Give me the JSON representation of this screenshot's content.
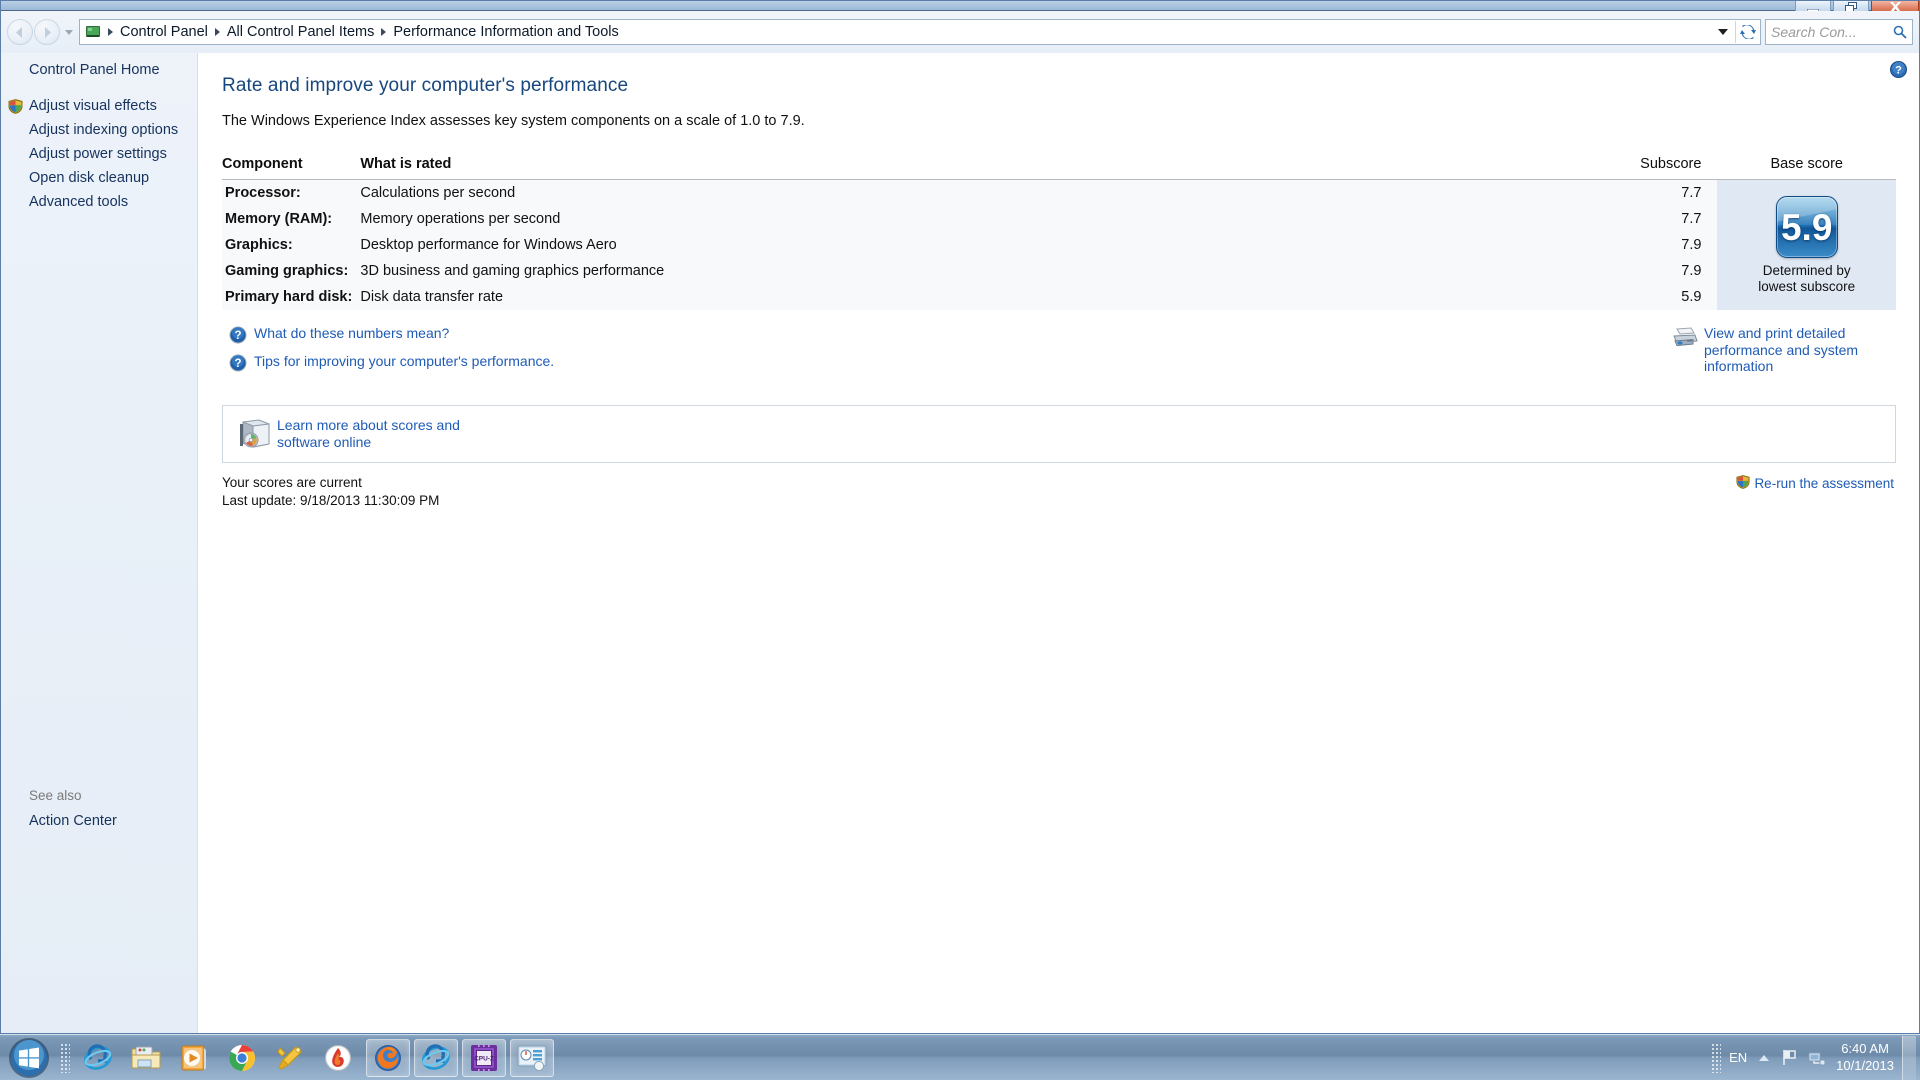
{
  "window": {
    "title_buttons": {
      "minimize": "Minimize",
      "restore": "Restore",
      "close": "Close"
    }
  },
  "nav": {
    "back_label": "Back",
    "forward_label": "Forward",
    "recent_pages_label": "Recent pages",
    "breadcrumbs": [
      "Control Panel",
      "All Control Panel Items",
      "Performance Information and Tools"
    ],
    "dropdown_label": "Previous locations",
    "refresh_label": "Refresh",
    "search_placeholder": "Search Con..."
  },
  "sidebar": {
    "home": "Control Panel Home",
    "items": [
      {
        "label": "Adjust visual effects",
        "shield": true
      },
      {
        "label": "Adjust indexing options",
        "shield": false
      },
      {
        "label": "Adjust power settings",
        "shield": false
      },
      {
        "label": "Open disk cleanup",
        "shield": false
      },
      {
        "label": "Advanced tools",
        "shield": false
      }
    ],
    "see_also_title": "See also",
    "see_also_items": [
      {
        "label": "Action Center"
      }
    ]
  },
  "content": {
    "help_label": "Help",
    "title": "Rate and improve your computer's performance",
    "subtitle": "The Windows Experience Index assesses key system components on a scale of 1.0 to 7.9.",
    "table": {
      "headers": {
        "component": "Component",
        "what_is_rated": "What is rated",
        "subscore": "Subscore",
        "base_score": "Base score"
      },
      "rows": [
        {
          "component": "Processor:",
          "what_is_rated": "Calculations per second",
          "subscore": "7.7"
        },
        {
          "component": "Memory (RAM):",
          "what_is_rated": "Memory operations per second",
          "subscore": "7.7"
        },
        {
          "component": "Graphics:",
          "what_is_rated": "Desktop performance for Windows Aero",
          "subscore": "7.9"
        },
        {
          "component": "Gaming graphics:",
          "what_is_rated": "3D business and gaming graphics performance",
          "subscore": "7.9"
        },
        {
          "component": "Primary hard disk:",
          "what_is_rated": "Disk data transfer rate",
          "subscore": "5.9"
        }
      ],
      "base_score": {
        "value": "5.9",
        "caption": "Determined by lowest subscore"
      }
    },
    "links": {
      "what_numbers_mean": "What do these numbers mean?",
      "tips_performance": "Tips for improving your computer's performance.",
      "view_print": "View and print detailed performance and system information",
      "learn_more": "Learn more about scores and software online"
    },
    "status": {
      "current": "Your scores are current",
      "last_update": "Last update: 9/18/2013 11:30:09 PM",
      "rerun": "Re-run the assessment"
    }
  },
  "taskbar": {
    "start_label": "Start",
    "pinned": [
      {
        "name": "internet-explorer"
      },
      {
        "name": "windows-explorer"
      },
      {
        "name": "windows-media-player"
      },
      {
        "name": "google-chrome"
      },
      {
        "name": "tools-utility"
      },
      {
        "name": "nero-burning"
      }
    ],
    "running": [
      {
        "name": "mozilla-firefox"
      },
      {
        "name": "internet-explorer"
      },
      {
        "name": "cpu-z",
        "label": "CPU-Z"
      },
      {
        "name": "performance-information-tools"
      }
    ],
    "tray": {
      "language": "EN",
      "show_hidden_label": "Show hidden icons",
      "action_center_label": "Action Center",
      "network_label": "Network",
      "time": "6:40 AM",
      "date": "10/1/2013",
      "show_desktop_label": "Show desktop"
    }
  },
  "colors": {
    "accent_link": "#1f5bb5",
    "title_blue": "#17477e",
    "score_tile": "#1c6fb5",
    "base_cell_bg": "#dfe8f3"
  }
}
